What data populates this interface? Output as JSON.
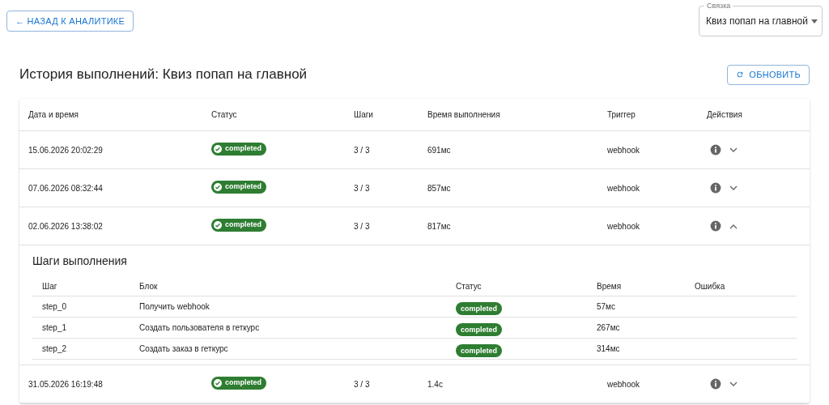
{
  "back_button": "← НАЗАД К АНАЛИТИКЕ",
  "link_select": {
    "label": "Связка",
    "value": "Квиз попап на главной"
  },
  "title": "История выполнений: Квиз попап на главной",
  "refresh_button": "ОБНОВИТЬ",
  "table": {
    "columns": [
      "Дата и время",
      "Статус",
      "Шаги",
      "Время выполнения",
      "Триггер",
      "Действия"
    ],
    "rows": [
      {
        "datetime": "15.06.2026 20:02:29",
        "status": "completed",
        "steps": "3 / 3",
        "duration": "691мс",
        "trigger": "webhook",
        "expanded": false
      },
      {
        "datetime": "07.06.2026 08:32:44",
        "status": "completed",
        "steps": "3 / 3",
        "duration": "857мс",
        "trigger": "webhook",
        "expanded": false
      },
      {
        "datetime": "02.06.2026 13:38:02",
        "status": "completed",
        "steps": "3 / 3",
        "duration": "817мс",
        "trigger": "webhook",
        "expanded": true,
        "details": {
          "title": "Шаги выполнения",
          "columns": [
            "Шаг",
            "Блок",
            "Статус",
            "Время",
            "Ошибка"
          ],
          "rows": [
            {
              "step": "step_0",
              "block": "Получить webhook",
              "status": "completed",
              "time": "57мс"
            },
            {
              "step": "step_1",
              "block": "Создать пользователя в геткурс",
              "status": "completed",
              "time": "267мс"
            },
            {
              "step": "step_2",
              "block": "Создать заказ в геткурс",
              "status": "completed",
              "time": "314мс"
            }
          ]
        }
      },
      {
        "datetime": "31.05.2026 16:19:48",
        "status": "completed",
        "steps": "3 / 3",
        "duration": "1.4с",
        "trigger": "webhook",
        "expanded": false
      }
    ]
  }
}
